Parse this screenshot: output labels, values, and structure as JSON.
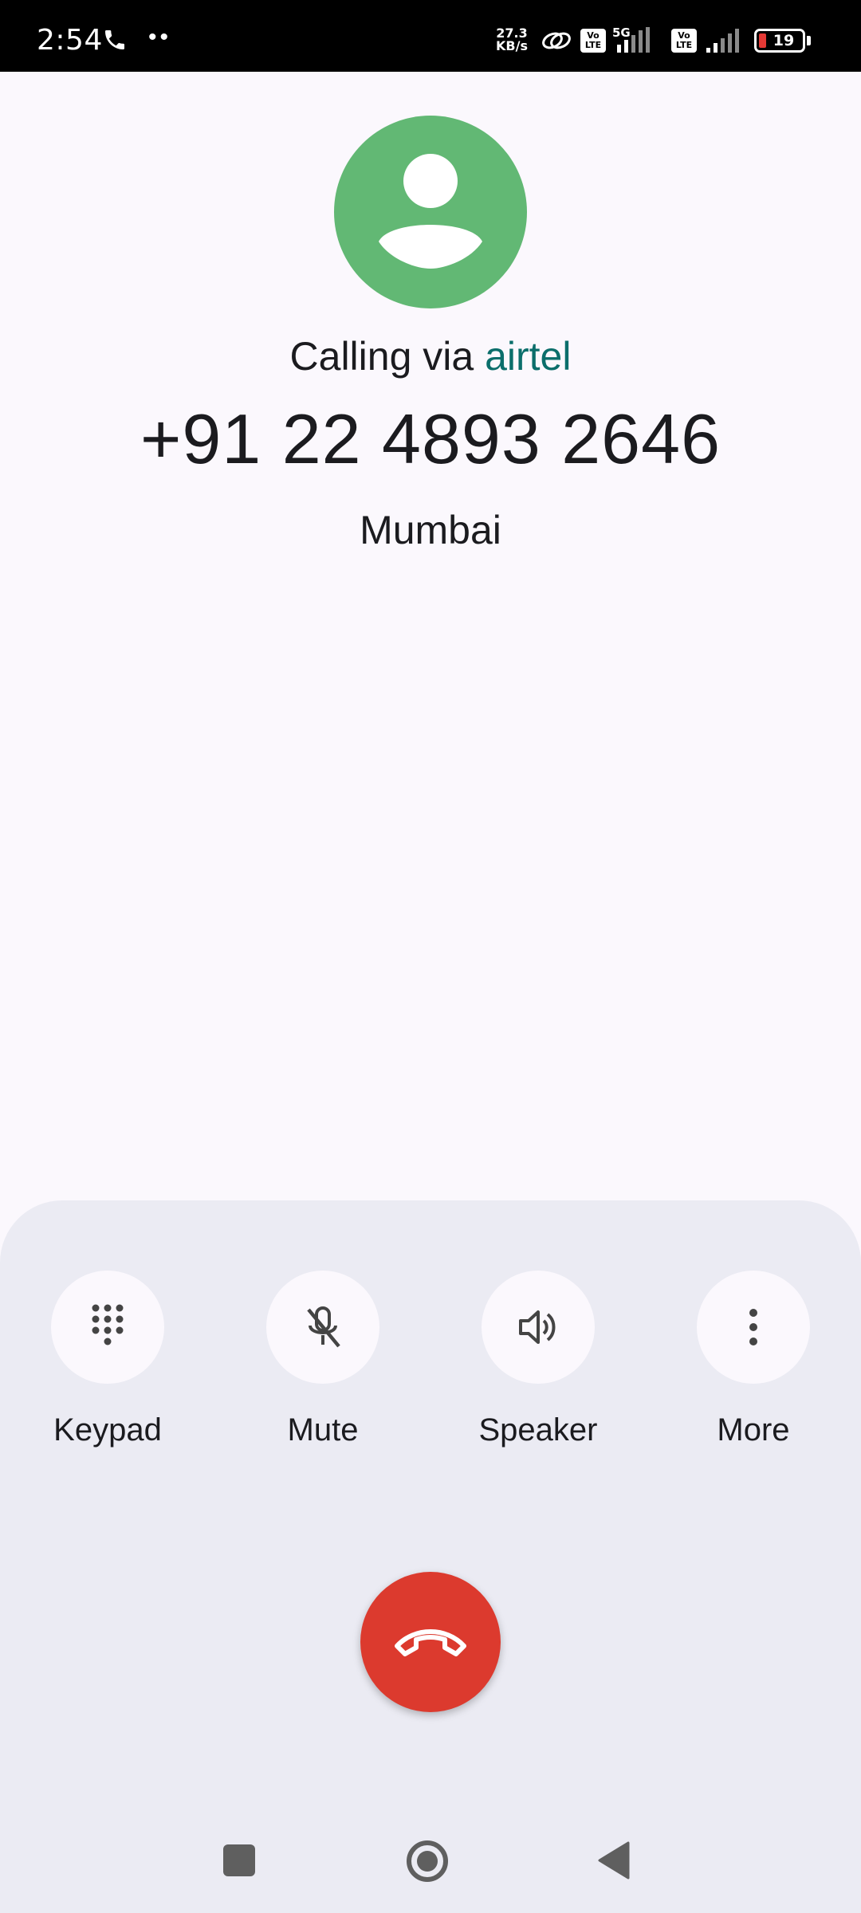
{
  "status_bar": {
    "time": "2:54",
    "dots": "••",
    "speed_value": "27.3",
    "speed_unit": "KB/s",
    "volte_label": "Vo LTE",
    "network_type": "5G",
    "battery_level": "19"
  },
  "caller": {
    "calling_via_prefix": "Calling via ",
    "carrier": "airtel",
    "number": "+91 22 4893 2646",
    "location": "Mumbai",
    "avatar_color": "#62b874",
    "carrier_color": "#0b6e6b"
  },
  "controls": [
    {
      "label": "Keypad",
      "icon": "dialpad-icon"
    },
    {
      "label": "Mute",
      "icon": "mic-off-icon"
    },
    {
      "label": "Speaker",
      "icon": "speaker-icon"
    },
    {
      "label": "More",
      "icon": "more-vert-icon"
    }
  ],
  "end_call": {
    "icon": "call-end-icon",
    "color": "#dc3a2e"
  },
  "nav": [
    "recents-square-icon",
    "home-circle-icon",
    "back-triangle-icon"
  ]
}
